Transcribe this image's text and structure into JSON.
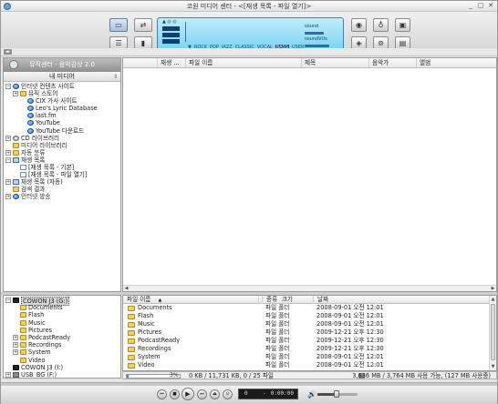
{
  "window": {
    "title": "코원 미디어 센터 - <[재생 목록 - 파일 열기]>",
    "min_glyph": "_",
    "max_glyph": "□",
    "close_glyph": "✕"
  },
  "panel": {
    "top_glyphs": "▲ ◎ ◎",
    "eq_tags": [
      "BBE",
      "MACH3BASS",
      "3D SURROUND",
      "MP ENHANCE"
    ],
    "eq_presets": [
      "ROCK",
      "POP",
      "JAZZ",
      "CLASSIC",
      "VOCAL",
      "BASS",
      "USER"
    ],
    "eq_selected": "BASS",
    "eq_arrow": "▼",
    "vol_labels": [
      "sound",
      "soundVUs"
    ],
    "vu_levels": [
      0.55,
      0.7,
      0.35
    ]
  },
  "left_panel": {
    "banner": "뮤직센터 - 음악감상 2.0",
    "my_media": "내 미디어",
    "collapse_glyph": "⇕",
    "tree": [
      {
        "label": "인터넷 컨텐츠 사이트",
        "level": 0,
        "exp": "−",
        "icon": "globe"
      },
      {
        "label": "뮤직 스토어",
        "level": 1,
        "exp": "+",
        "icon": "folder"
      },
      {
        "label": "CIX 가사 사이트",
        "level": 2,
        "exp": "",
        "icon": "globe"
      },
      {
        "label": "Leo's Lyric Database",
        "level": 2,
        "exp": "",
        "icon": "globe"
      },
      {
        "label": "last.fm",
        "level": 2,
        "exp": "",
        "icon": "globe"
      },
      {
        "label": "YouTube",
        "level": 2,
        "exp": "",
        "icon": "globe"
      },
      {
        "label": "YouTube 다운로드",
        "level": 2,
        "exp": "",
        "icon": "globe"
      },
      {
        "label": "CD 라이브러리",
        "level": 0,
        "exp": "+",
        "icon": "cd"
      },
      {
        "label": "미디어 라이브러리",
        "level": 0,
        "exp": "",
        "icon": "folder"
      },
      {
        "label": "자동 분류",
        "level": 0,
        "exp": "+",
        "icon": "folder"
      },
      {
        "label": "재생 목록",
        "level": 0,
        "exp": "−",
        "icon": "list"
      },
      {
        "label": "[재생 목록 - 기본]",
        "level": 1,
        "exp": "",
        "icon": "doc"
      },
      {
        "label": "[재생 목록 - 파일 열기]",
        "level": 1,
        "exp": "",
        "icon": "doc"
      },
      {
        "label": "재생 목록 (자동)",
        "level": 0,
        "exp": "+",
        "icon": "list"
      },
      {
        "label": "검색 결과",
        "level": 0,
        "exp": "",
        "icon": "folder"
      },
      {
        "label": "인터넷 방송",
        "level": 0,
        "exp": "+",
        "icon": "globe"
      }
    ]
  },
  "playlist_columns": [
    "재생 ...",
    "파일 이름",
    "제목",
    "음악가",
    "앨범"
  ],
  "hscroll": {
    "left_glyph": "◀",
    "right_glyph": "▶"
  },
  "devices": [
    {
      "label": "COWON J3 (G:)",
      "level": 0,
      "exp": "−",
      "icon": "drive",
      "selected": true
    },
    {
      "label": "Documents",
      "level": 1,
      "exp": "",
      "icon": "folder"
    },
    {
      "label": "Flash",
      "level": 1,
      "exp": "",
      "icon": "folder"
    },
    {
      "label": "Music",
      "level": 1,
      "exp": "",
      "icon": "folder"
    },
    {
      "label": "Pictures",
      "level": 1,
      "exp": "",
      "icon": "folder"
    },
    {
      "label": "PodcastReady",
      "level": 1,
      "exp": "+",
      "icon": "folder"
    },
    {
      "label": "Recordings",
      "level": 1,
      "exp": "+",
      "icon": "folder"
    },
    {
      "label": "System",
      "level": 1,
      "exp": "+",
      "icon": "folder"
    },
    {
      "label": "Video",
      "level": 1,
      "exp": "",
      "icon": "folder"
    },
    {
      "label": "COWON J3 (I:)",
      "level": 0,
      "exp": "",
      "icon": "drive"
    },
    {
      "label": "USB_BG (F:)",
      "level": 0,
      "exp": "+",
      "icon": "usb"
    }
  ],
  "file_columns": [
    "파일 이름",
    "크기",
    "종류",
    "날짜"
  ],
  "file_sort_glyph": "▲",
  "files": [
    {
      "name": "Documents",
      "size": "",
      "type": "파일 폴더",
      "date": "2008-09-01 오전 12:01"
    },
    {
      "name": "Flash",
      "size": "",
      "type": "파일 폴더",
      "date": "2008-09-01 오전 12:01"
    },
    {
      "name": "Music",
      "size": "",
      "type": "파일 폴더",
      "date": "2008-09-01 오전 12:01"
    },
    {
      "name": "Pictures",
      "size": "",
      "type": "파일 폴더",
      "date": "2009-12-21 오후 12:30"
    },
    {
      "name": "PodcastReady",
      "size": "",
      "type": "파일 폴더",
      "date": "2009-12-21 오후 12:30"
    },
    {
      "name": "Recordings",
      "size": "",
      "type": "파일 폴더",
      "date": "2009-12-21 오후 12:30"
    },
    {
      "name": "System",
      "size": "",
      "type": "파일 폴더",
      "date": "2008-09-01 오전 12:01"
    },
    {
      "name": "Video",
      "size": "",
      "type": "파일 폴더",
      "date": "2008-09-01 오전 12:01"
    }
  ],
  "vscroll": {
    "up_glyph": "▲",
    "down_glyph": "▼"
  },
  "status": {
    "progress_pct": "3%",
    "progress_fraction": 0.03,
    "transfer": "0 KB / 11,731 KB, 0 / 25 파일",
    "disk": "3,636 MB / 3,764 MB 사용 가능, (127 MB 사용중)"
  },
  "player": {
    "buttons": [
      "⏮",
      "■",
      "▶",
      "⏭",
      "⏏",
      "⊙"
    ],
    "track": "0",
    "state": "-",
    "time": "0:00:00",
    "vol_glyph": "🔊",
    "volume_level": 0.45
  },
  "icons": {
    "toolbar_left": [
      "library-icon",
      "sync-icon",
      "playlist-icon",
      "device-icon"
    ],
    "toolbar_right": [
      "speaker-icon",
      "eq-icon",
      "settings-icon",
      "record-icon",
      "repeat-icon",
      "skin-icon"
    ]
  }
}
